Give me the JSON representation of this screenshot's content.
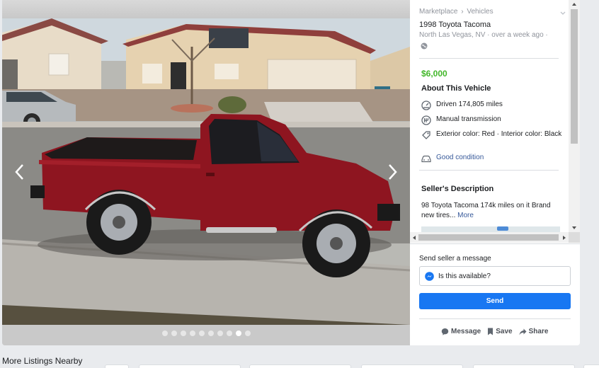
{
  "header": {
    "breadcrumb": [
      "Marketplace",
      "Vehicles"
    ],
    "breadcrumb_sep": "›",
    "title": "1998 Toyota Tacoma",
    "location_time": "North Las Vegas, NV · over a week ago ·"
  },
  "listing": {
    "price": "$6,000",
    "about_heading": "About This Vehicle",
    "attributes": [
      {
        "icon": "odometer-icon",
        "text": "Driven 174,805 miles"
      },
      {
        "icon": "transmission-icon",
        "text": "Manual transmission"
      },
      {
        "icon": "paint-tag-icon",
        "text": "Exterior color: Red · Interior color: Black"
      },
      {
        "icon": "car-icon",
        "text": "Good condition"
      }
    ],
    "description_heading": "Seller's Description",
    "description": "98 Toyota Tacoma 174k miles on it Brand new tires...",
    "more_link": "More"
  },
  "gallery": {
    "photo_count": 10,
    "active_index": 8
  },
  "message": {
    "label": "Send seller a message",
    "input_value": "Is this available?",
    "send_label": "Send"
  },
  "actions": {
    "message_label": "Message",
    "save_label": "Save",
    "share_label": "Share"
  },
  "footer": {
    "more_listings": "More Listings Nearby"
  },
  "colors": {
    "price_green": "#42b72a",
    "link_blue": "#365899",
    "button_blue": "#1877f2",
    "truck_red": "#8e1520"
  }
}
